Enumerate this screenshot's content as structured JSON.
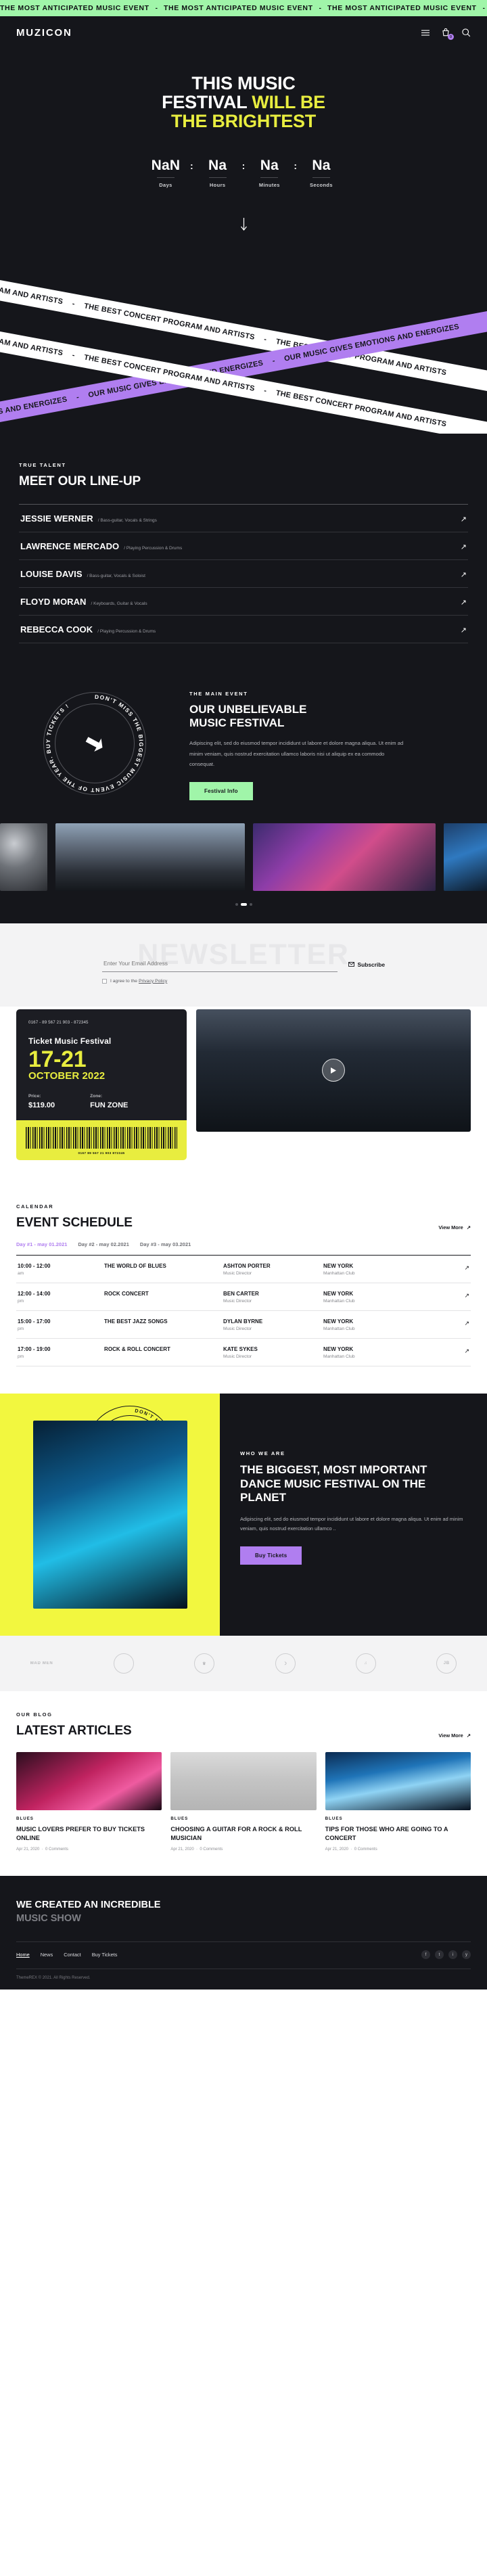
{
  "ticker": {
    "text": "THE MOST ANTICIPATED MUSIC EVENT",
    "separator": "-"
  },
  "header": {
    "logo": "MUZICON",
    "cart_count": "0",
    "menu_icon": "hamburger-icon",
    "cart_icon": "cart-icon",
    "search_icon": "search-icon"
  },
  "hero": {
    "line1": "THIS MUSIC",
    "line2_white": "FESTIVAL",
    "line2_yellow": "WILL BE",
    "line3": "THE BRIGHTEST",
    "countdown": {
      "days_value": "NaN",
      "days_label": "Days",
      "hours_value": "Na",
      "hours_label": "Hours",
      "minutes_value": "Na",
      "minutes_label": "Minutes",
      "seconds_value": "Na",
      "seconds_label": "Seconds",
      "separator": ":"
    }
  },
  "bands": {
    "white_text": "THE BEST CONCERT PROGRAM AND ARTISTS",
    "purple_text": "OUR MUSIC GIVES EMOTIONS AND ENERGIZES",
    "dash": "-"
  },
  "lineup": {
    "eyebrow": "TRUE TALENT",
    "title": "MEET OUR LINE-UP",
    "artists": [
      {
        "name": "JESSIE WERNER",
        "role": "/ Bass-guitar, Vocals & Strings"
      },
      {
        "name": "LAWRENCE MERCADO",
        "role": "/ Playing Percussion & Drums"
      },
      {
        "name": "LOUISE DAVIS",
        "role": "/ Bass-guitar, Vocals & Soloist"
      },
      {
        "name": "FLOYD MORAN",
        "role": "/ Keyboards, Guitar & Vocals"
      },
      {
        "name": "REBECCA COOK",
        "role": "/ Playing Percussion & Drums"
      }
    ]
  },
  "main_event": {
    "circle_text": "DON'T MISS THE BIGGEST MUSIC EVENT OF THE YEAR. BUY TICKETS !",
    "eyebrow": "THE MAIN EVENT",
    "title_line1": "OUR UNBELIEVABLE",
    "title_line2": "MUSIC FESTIVAL",
    "paragraph": "Adipiscing elit, sed do eiusmod tempor incididunt ut labore et dolore magna aliqua. Ut enim ad minim veniam, quis nostrud exercitation ullamco laboris nisi ut aliquip ex ea commodo consequat.",
    "button": "Festival Info"
  },
  "newsletter": {
    "watermark": "NEWSLETTER",
    "placeholder": "Enter Your Email Address",
    "value": "",
    "subscribe": "Subscribe",
    "mail_icon": "mail-icon",
    "agree_prefix": "I agree to the ",
    "agree_link": "Privacy Policy"
  },
  "ticket": {
    "code": "0167 - 89 567 21 903 - 872345",
    "name": "Ticket Music Festival",
    "dates": "17-21",
    "month": "OCTOBER 2022",
    "price_label": "Price:",
    "price_value": "$119.00",
    "zone_label": "Zone:",
    "zone_value": "FUN ZONE",
    "barcode_number": "0167 89 567 21 903 872345",
    "play_icon": "play-icon"
  },
  "schedule": {
    "eyebrow": "CALENDAR",
    "title": "EVENT SCHEDULE",
    "view_more": "View More",
    "tabs": [
      {
        "label": "Day #1 - may 01.2021",
        "active": true
      },
      {
        "label": "Day #2 - may 02.2021",
        "active": false
      },
      {
        "label": "Day #3 - may 03.2021",
        "active": false
      }
    ],
    "rows": [
      {
        "time": "10:00 - 12:00",
        "ampm": "am",
        "event": "THE WORLD OF BLUES",
        "person": "ASHTON PORTER",
        "person_role": "Music Director",
        "place": "NEW YORK",
        "venue": "Manhattan Club"
      },
      {
        "time": "12:00 - 14:00",
        "ampm": "pm",
        "event": "ROCK CONCERT",
        "person": "BEN CARTER",
        "person_role": "Music Director",
        "place": "NEW YORK",
        "venue": "Manhattan Club"
      },
      {
        "time": "15:00 - 17:00",
        "ampm": "pm",
        "event": "THE BEST JAZZ SONGS",
        "person": "DYLAN BYRNE",
        "person_role": "Music Director",
        "place": "NEW YORK",
        "venue": "Manhattan Club"
      },
      {
        "time": "17:00 - 19:00",
        "ampm": "pm",
        "event": "ROCK & ROLL CONCERT",
        "person": "KATE SYKES",
        "person_role": "Music Director",
        "place": "NEW YORK",
        "venue": "Manhattan Club"
      }
    ]
  },
  "who_we_are": {
    "circle_text": "DON'T MISS THE BIGGEST MUSIC EVENT OF THE YEAR",
    "eyebrow": "WHO WE ARE",
    "title": "THE BIGGEST, MOST IMPORTANT DANCE MUSIC FESTIVAL ON THE PLANET",
    "paragraph": "Adipiscing elit, sed do eiusmod tempor incididunt ut labore et dolore magna aliqua. Ut enim ad minim veniam, quis nostrud exercitation ullamco ..",
    "button": "Buy Tickets"
  },
  "logos": [
    {
      "label": "MAD MEN"
    },
    {
      "label": ""
    },
    {
      "label": ""
    },
    {
      "label": ""
    },
    {
      "label": ""
    },
    {
      "label": ""
    }
  ],
  "blog": {
    "eyebrow": "OUR BLOG",
    "title": "LATEST ARTICLES",
    "view_more": "View More",
    "posts": [
      {
        "category": "BLUES",
        "title": "MUSIC LOVERS PREFER TO BUY TICKETS ONLINE",
        "date": "Apr 21, 2020",
        "comments": "0 Comments"
      },
      {
        "category": "BLUES",
        "title": "CHOOSING A GUITAR FOR A ROCK & ROLL MUSICIAN",
        "date": "Apr 21, 2020",
        "comments": "0 Comments"
      },
      {
        "category": "BLUES",
        "title": "TIPS FOR THOSE WHO ARE GOING TO A CONCERT",
        "date": "Apr 21, 2020",
        "comments": "0 Comments"
      }
    ]
  },
  "footer": {
    "title_line1": "WE CREATED AN INCREDIBLE",
    "title_line2": "MUSIC SHOW",
    "links": [
      {
        "label": "Home",
        "active": true
      },
      {
        "label": "News",
        "active": false
      },
      {
        "label": "Contact",
        "active": false
      },
      {
        "label": "Buy Tickets",
        "active": false
      }
    ],
    "social": [
      {
        "icon": "facebook-icon",
        "glyph": "f"
      },
      {
        "icon": "twitter-icon",
        "glyph": "t"
      },
      {
        "icon": "instagram-icon",
        "glyph": "i"
      },
      {
        "icon": "youtube-icon",
        "glyph": "y"
      }
    ],
    "copyright": "ThemeREX © 2021. All Rights Reserved."
  },
  "colors": {
    "dark": "#15161b",
    "yellow": "#e8ed3f",
    "mint": "#a0f5a9",
    "purple": "#b07ef0"
  }
}
